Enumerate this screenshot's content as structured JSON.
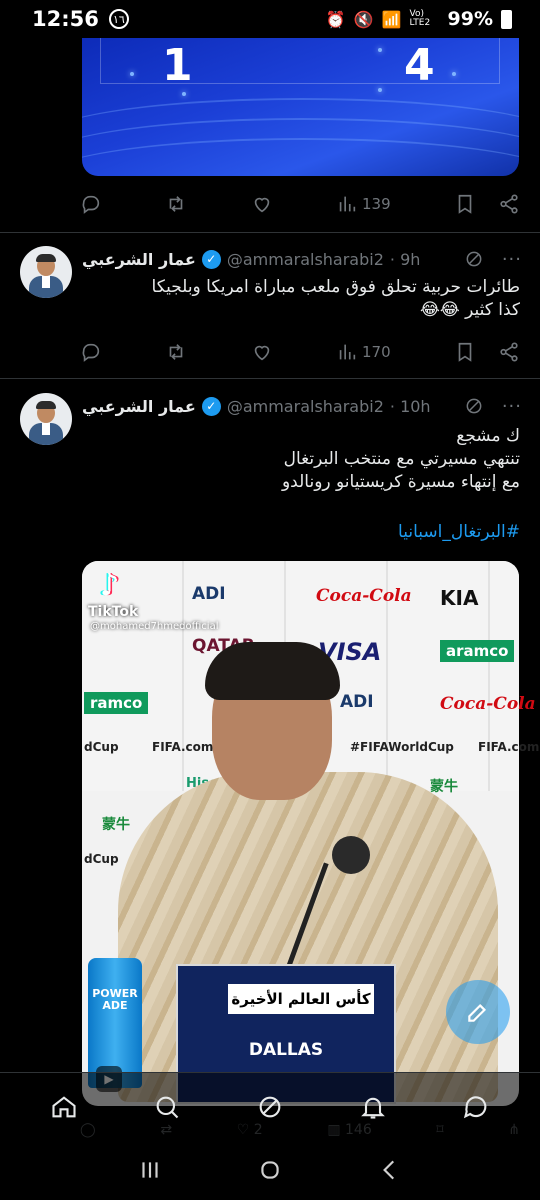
{
  "status_bar": {
    "time": "12:56",
    "notification_badge": "١٦",
    "network_label": "Vo) LTE2",
    "battery_percent": "99%"
  },
  "top_card": {
    "score_left": "1",
    "score_right": "4",
    "views": "139"
  },
  "tweets": [
    {
      "author": "عمار الشرعبي",
      "handle": "@ammaralsharabi2",
      "time": "· 9h",
      "text_lines": [
        "طائرات حربية تحلق فوق ملعب مباراة امريكا وبلجيكا",
        "كذا كثير 😂😂"
      ],
      "views": "170"
    },
    {
      "author": "عمار الشرعبي",
      "handle": "@ammaralsharabi2",
      "time": "· 10h",
      "text_lines": [
        "ك مشجع",
        "تنتهي مسيرتي مع منتخب البرتغال",
        "مع إنتهاء مسيرة كريستيانو رونالدو"
      ],
      "hashtag": "#البرتغال_اسبانيا",
      "views": "146",
      "likes": "2"
    }
  ],
  "media": {
    "tiktok_name": "TikTok",
    "tiktok_user": "@mohamed7hmedofficial",
    "sponsors": [
      "ADI",
      "Coca-Cola",
      "KIA",
      "QATAR",
      "VISA",
      "aramco",
      "ramco",
      "ADI",
      "Coca-Cola",
      "FIFA.com",
      "#FIFAWorldCup",
      "FIFA.com",
      "Hisense",
      "蒙牛",
      "蒙牛",
      "dCup",
      "dCup"
    ],
    "caption": "كأس العالم الأخيرة",
    "city": "DALLAS",
    "bottle_label": "POWER ADE"
  },
  "colors": {
    "background": "#000000",
    "text": "#e7e9ea",
    "muted": "#71767b",
    "accent": "#1d9bf0",
    "divider": "#2f3336"
  },
  "bottom_nav": [
    "home-icon",
    "search-icon",
    "spaces-icon",
    "notifications-icon",
    "messages-icon"
  ],
  "system_nav": [
    "recents-icon",
    "home-circle-icon",
    "back-icon"
  ]
}
